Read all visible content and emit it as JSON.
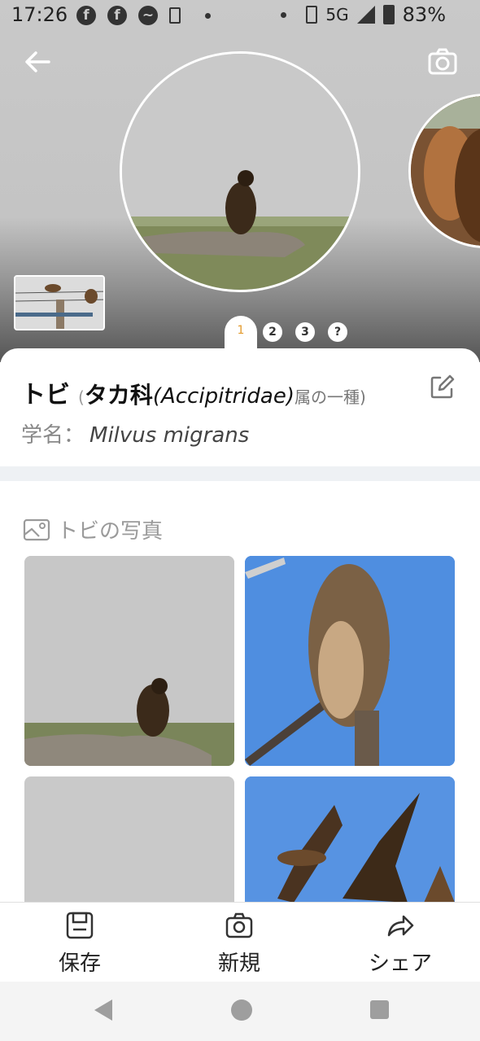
{
  "status_bar": {
    "time": "17:26",
    "network": "5G",
    "battery": "83%",
    "notification_icons": [
      "facebook-icon",
      "facebook-icon",
      "messenger-icon",
      "sim-icon"
    ]
  },
  "hero": {
    "pager": {
      "active": "1",
      "pages": [
        "2",
        "3",
        "?"
      ]
    }
  },
  "species": {
    "name": "トビ",
    "paren_open": "(",
    "family_jp": "タカ科",
    "family_latin": "(Accipitridae)",
    "suffix": "属の一種)",
    "sci_label": "学名：",
    "sci_name": "Milvus migrans"
  },
  "photos": {
    "title": "トビの写真",
    "icon": "image-icon"
  },
  "bottom_bar": {
    "save": "保存",
    "new": "新規",
    "share": "シェア"
  },
  "colors": {
    "accent": "#e39a2c",
    "sky": "#4f8ee0",
    "divider": "#eef1f4"
  }
}
